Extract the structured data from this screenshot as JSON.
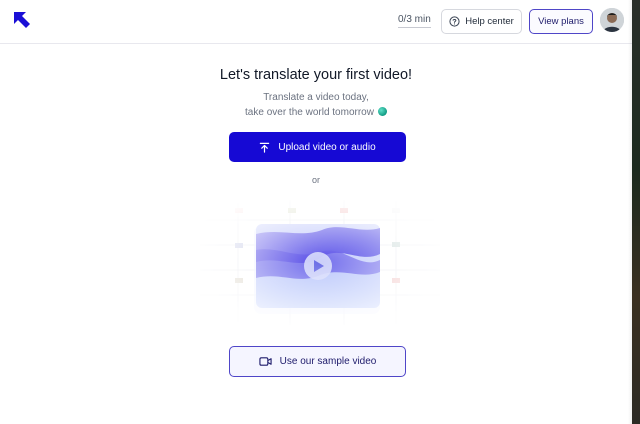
{
  "header": {
    "logo_icon": "arrow-up-left-logo",
    "usage": "0/3 min",
    "help_label": "Help center",
    "help_icon": "question-circle-icon",
    "plans_label": "View plans",
    "avatar_icon": "user-avatar"
  },
  "main": {
    "title": "Let's translate your first video!",
    "subtitle_line1": "Translate a video today,",
    "subtitle_line2": "take over the world tomorrow",
    "upload_label": "Upload video or audio",
    "upload_icon": "upload-arrow-icon",
    "or_text": "or",
    "sample_label": "Use our sample video",
    "sample_icon": "video-camera-icon"
  },
  "colors": {
    "accent": "#1609d4",
    "outline_accent": "#4f46c8",
    "text_muted": "#6b7280"
  }
}
